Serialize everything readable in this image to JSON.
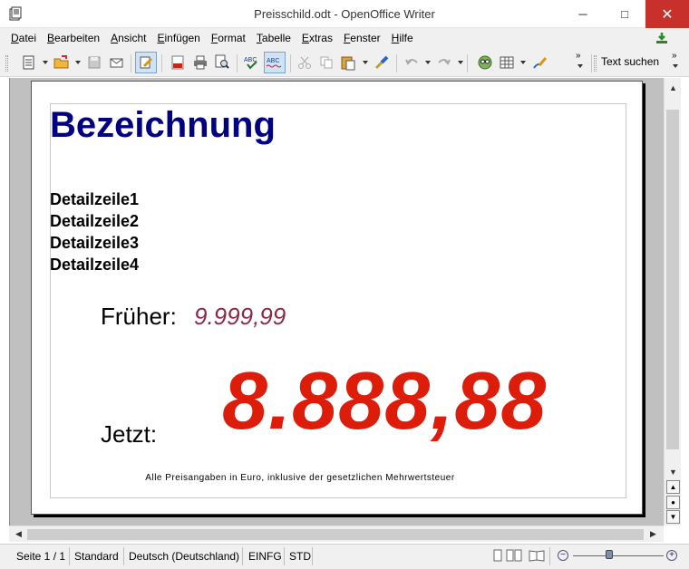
{
  "window": {
    "title": "Preisschild.odt - OpenOffice Writer",
    "minimize": "─",
    "maximize": "□",
    "close": "✕"
  },
  "menu": {
    "items": [
      {
        "u": "D",
        "rest": "atei"
      },
      {
        "u": "B",
        "rest": "earbeiten"
      },
      {
        "u": "A",
        "rest": "nsicht"
      },
      {
        "u": "E",
        "rest": "infügen"
      },
      {
        "u": "F",
        "rest": "ormat"
      },
      {
        "u": "T",
        "rest": "abelle"
      },
      {
        "u": "E",
        "rest": "xtras"
      },
      {
        "u": "F",
        "rest": "enster"
      },
      {
        "u": "H",
        "rest": "ilfe"
      }
    ]
  },
  "toolbar": {
    "find_label": "Text suchen",
    "overflow": "»",
    "icons": [
      "new-icon",
      "open-icon",
      "save-icon",
      "email-icon",
      "edit-mode-icon",
      "pdf-icon",
      "print-icon",
      "print-preview-icon",
      "spellcheck-icon",
      "autospellcheck-icon",
      "cut-icon",
      "copy-icon",
      "paste-icon",
      "clone-format-icon",
      "undo-icon",
      "redo-icon",
      "navigator-icon",
      "table-icon",
      "draw-icon"
    ]
  },
  "document": {
    "heading": "Bezeichnung",
    "details": [
      "Detailzeile1",
      "Detailzeile2",
      "Detailzeile3",
      "Detailzeile4"
    ],
    "old_price_label": "Früher:",
    "old_price": "9.999,99",
    "new_price_label": "Jetzt:",
    "new_price": "8.888,88",
    "footnote": "Alle Preisangaben in Euro, inklusive der gesetzlichen Mehrwertsteuer"
  },
  "statusbar": {
    "page": "Seite 1 / 1",
    "style": "Standard",
    "language": "Deutsch (Deutschland)",
    "insert_mode": "EINFG",
    "selection_mode": "STD"
  },
  "colors": {
    "heading": "#000080",
    "old_price": "#8a2b46",
    "new_price": "#dd1c0a",
    "close_button": "#c7302b"
  }
}
